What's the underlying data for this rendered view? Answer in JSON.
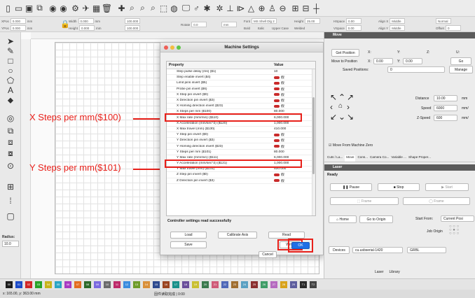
{
  "toolbar": {
    "fields_row1": [
      {
        "label": "XPos",
        "value": "0.000",
        "unit": "mm"
      },
      {
        "label": "Width",
        "value": "0.000",
        "unit": "mm"
      },
      {
        "label": "Font",
        "value": "MS Shell Dlg 2"
      },
      {
        "label": "Height",
        "value": "25.00"
      },
      {
        "label": "HSpace",
        "value": "0.00"
      },
      {
        "label": "Align X",
        "value": "Middle"
      },
      {
        "label": "Normal",
        "value": ""
      }
    ],
    "fields_row2": [
      {
        "label": "YPos",
        "value": "0.000",
        "unit": "mm"
      },
      {
        "label": "Height",
        "value": "0.000",
        "unit": "mm"
      },
      {
        "label": "Rotate",
        "value": "0.0"
      },
      {
        "label": "Bold",
        "value": ""
      },
      {
        "label": "Italic",
        "value": ""
      },
      {
        "label": "Upper Case",
        "value": ""
      },
      {
        "label": "Welded",
        "value": ""
      },
      {
        "label": "VSpace",
        "value": "0.00"
      },
      {
        "label": "Align Y",
        "value": "Middle"
      },
      {
        "label": "Offset",
        "value": "0"
      }
    ],
    "mm_btn": "mm",
    "pct_label": "100.000"
  },
  "lefttools": {
    "radius_label": "Radius:",
    "radius_value": "10.0"
  },
  "annotations": {
    "x_steps": "X Steps per mm($100)",
    "y_steps": "Y Steps per mm($101)"
  },
  "dialog": {
    "title": "Machine Settings",
    "col_property": "Property",
    "col_value": "Value",
    "rows": [
      {
        "name": "Step pulse delay (ms) ($1)",
        "value": "10",
        "switch": false
      },
      {
        "name": "Step enable invert ($4)",
        "value": "假",
        "switch": true
      },
      {
        "name": "Limit pins invert ($5)",
        "value": "假",
        "switch": true
      },
      {
        "name": "Probe pin invert ($6)",
        "value": "假",
        "switch": true
      },
      {
        "name": "X Step pin invert ($0)",
        "value": "假",
        "switch": true
      },
      {
        "name": "X Direction pin invert ($3)",
        "value": "假",
        "switch": true
      },
      {
        "name": "X Homing direction invert ($23)",
        "value": "假",
        "switch": true
      },
      {
        "name": "X Steps per mm ($100)",
        "value": "80.000",
        "switch": false
      },
      {
        "name": "X Max rate (mm/min) ($110)",
        "value": "6,000.000",
        "switch": false
      },
      {
        "name": "X Acceleration (mm/sec^2) ($120)",
        "value": "1,000.000",
        "switch": false
      },
      {
        "name": "X Max travel (mm) ($130)",
        "value": "410.000",
        "switch": false
      },
      {
        "name": "Y Step pin invert ($0)",
        "value": "假",
        "switch": true
      },
      {
        "name": "Y Direction pin invert ($3)",
        "value": "假",
        "switch": true
      },
      {
        "name": "Y Homing direction invert ($23)",
        "value": "假",
        "switch": true
      },
      {
        "name": "Y Steps per mm ($101)",
        "value": "80.000",
        "switch": false
      },
      {
        "name": "Y Max rate (mm/min) ($111)",
        "value": "6,000.000",
        "switch": false
      },
      {
        "name": "Y Acceleration (mm/sec^2) ($121)",
        "value": "1,000.000",
        "switch": false
      },
      {
        "name": "Y Max travel (mm) ($131)",
        "value": "400.000",
        "switch": false
      },
      {
        "name": "Z Step pin invert ($0)",
        "value": "假",
        "switch": true
      },
      {
        "name": "Z Direction pin invert ($3)",
        "value": "假",
        "switch": true
      }
    ],
    "status": "Controller settings read successfully",
    "btn_load": "Load",
    "btn_calibrate": "Calibrate Axis",
    "btn_read": "Read",
    "btn_save": "Save",
    "btn_write": "Write",
    "btn_cancel": "Cancel",
    "btn_ok": "OK"
  },
  "right_panel": {
    "move_header": "Move",
    "get_position": "Get Position",
    "x_lbl": "X:",
    "y_lbl": "Y:",
    "z_lbl": "Z:",
    "u_lbl": "U:",
    "move_to_position": "Move to Position",
    "mx": "0.00",
    "my": "0.00",
    "go": "Go",
    "saved_positions": "Saved Positions:",
    "saved_count": "0",
    "manage": "Manage",
    "distance_lbl": "Distance",
    "distance_val": "10.00",
    "distance_unit": "mm",
    "speed_lbl": "Speed",
    "speed_val": "6000",
    "speed_unit": "mm/",
    "zspeed_lbl": "Z-Speed",
    "zspeed_val": "600",
    "zspeed_unit": "mm/",
    "move_from_zero": "Move From Machine Zero",
    "tabs": [
      "Cuts / La...",
      "Move",
      "Cons...",
      "Camera Co...",
      "Variable ...",
      "Shape Proper..."
    ],
    "laser_header": "Laser",
    "ready": "Ready",
    "pause": "Pause",
    "stop": "Stop",
    "start": "Start",
    "frame1": "Frame",
    "frame2": "Frame",
    "home": "Home",
    "go_origin": "Go to Origin",
    "start_from_lbl": "Start From:",
    "start_from_val": "Current Posi",
    "job_origin": "Job Origin",
    "devices": "Devices",
    "device_port": "cu.usbserial-1420",
    "device_model": "GRBL",
    "bottom_tabs": [
      "Laser",
      "Library"
    ]
  },
  "palette": [
    "00",
    "01",
    "02",
    "03",
    "04",
    "05",
    "06",
    "07",
    "08",
    "09",
    "10",
    "11",
    "12",
    "13",
    "14",
    "15",
    "16",
    "17",
    "18",
    "19",
    "20",
    "21",
    "22",
    "23",
    "24",
    "25",
    "26",
    "27",
    "28",
    "29",
    "T1",
    "T2"
  ],
  "palette_colors": [
    "#1d1d1d",
    "#1c4bc9",
    "#d12626",
    "#27a327",
    "#c8b31a",
    "#2aa5c4",
    "#a83ac2",
    "#e36d1f",
    "#2c6a2a",
    "#7b6ae0",
    "#6c6c6c",
    "#bd2b6a",
    "#3c8ddf",
    "#6f9c2a",
    "#d9903a",
    "#2d4a8f",
    "#9a4420",
    "#19918a",
    "#6b4f9a",
    "#c9c032",
    "#3b7a4e",
    "#cf5a78",
    "#4f68b8",
    "#a06e30",
    "#5aa0c2",
    "#8b2f2f",
    "#3f9d66",
    "#b56bc0",
    "#d8a21a",
    "#5e5e9e",
    "#2a2a2a",
    "#444444"
  ],
  "statusbar": {
    "coords": "x: 165.00, y: 363.00 mm",
    "message": "固件读取完成 | 0:00"
  }
}
